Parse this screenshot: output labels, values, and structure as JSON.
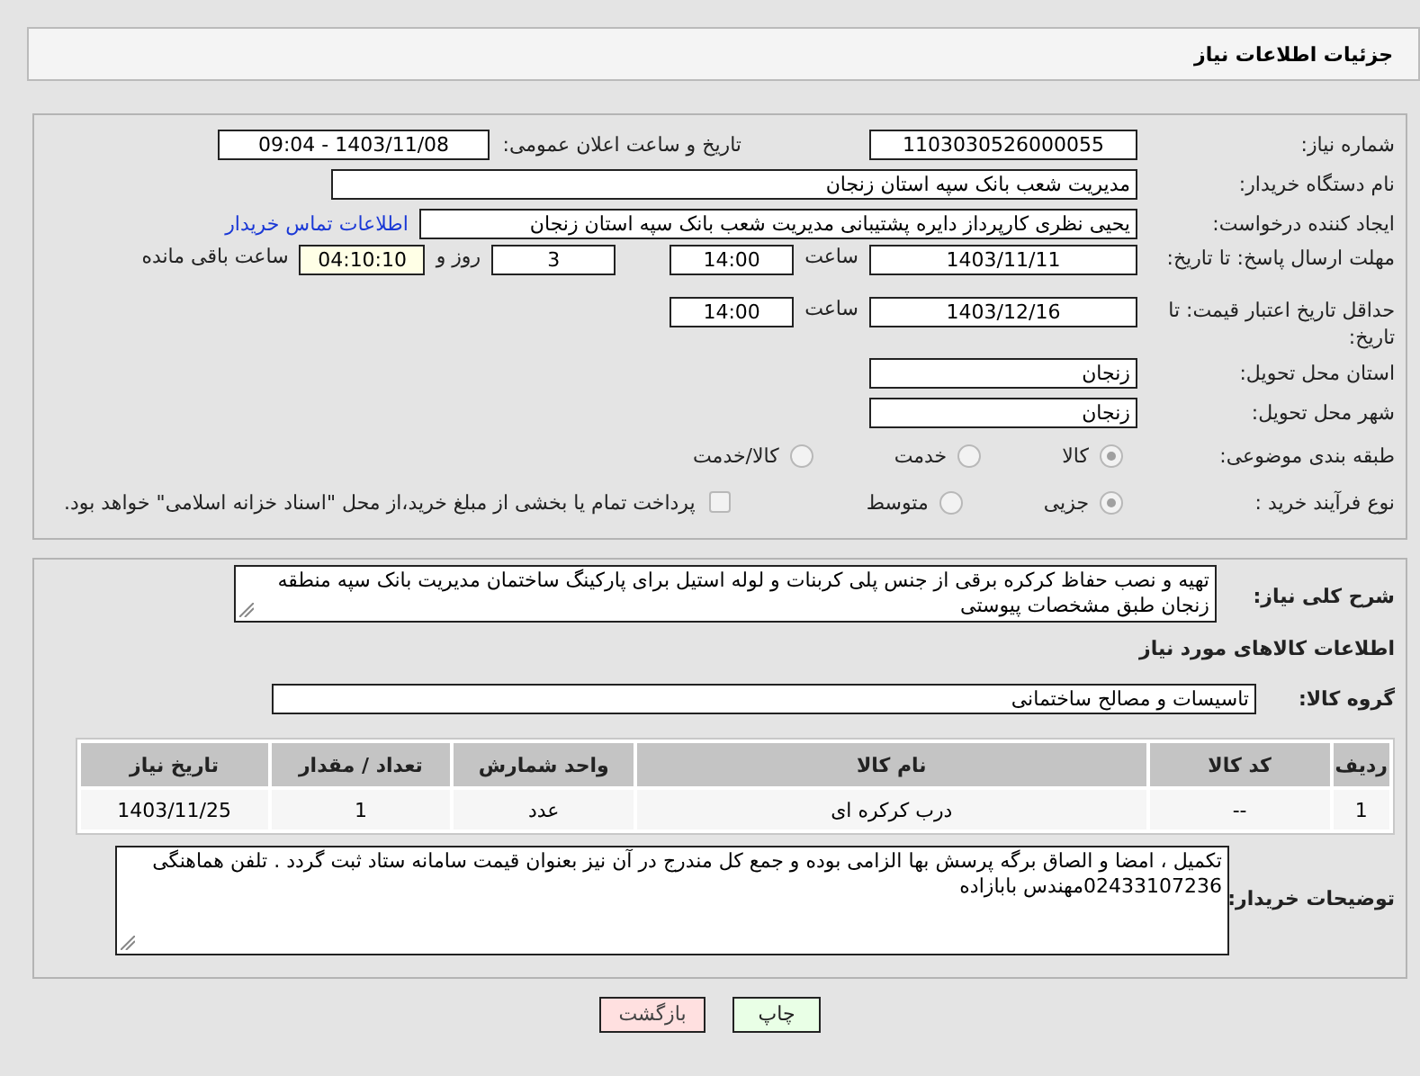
{
  "header": {
    "title": "جزئیات اطلاعات نیاز"
  },
  "need_number": {
    "label": "شماره نیاز:",
    "value": "1103030526000055"
  },
  "announce": {
    "label": "تاریخ و ساعت اعلان عمومی:",
    "value": "1403/11/08 - 09:04"
  },
  "buyer": {
    "label": "نام دستگاه خریدار:",
    "value": "مدیریت شعب بانک سپه استان زنجان"
  },
  "requester": {
    "label": "ایجاد کننده درخواست:",
    "value": "یحیی نظری کارپرداز دایره پشتیبانی  مدیریت شعب بانک سپه استان زنجان",
    "link": "اطلاعات تماس خریدار"
  },
  "deadline": {
    "label": "مهلت ارسال پاسخ: تا تاریخ:",
    "date": "1403/11/11",
    "time_label": "ساعت",
    "time": "14:00",
    "days": "3",
    "days_label": "روز و",
    "remaining": "04:10:10",
    "remaining_label": "ساعت باقی مانده"
  },
  "validity": {
    "label": "حداقل تاریخ اعتبار قیمت: تا تاریخ:",
    "date": "1403/12/16",
    "time_label": "ساعت",
    "time": "14:00"
  },
  "province": {
    "label": "استان محل تحویل:",
    "value": "زنجان"
  },
  "city": {
    "label": "شهر محل تحویل:",
    "value": "زنجان"
  },
  "category": {
    "label": "طبقه بندی موضوعی:",
    "options": [
      {
        "label": "کالا",
        "selected": true
      },
      {
        "label": "خدمت",
        "selected": false
      },
      {
        "label": "کالا/خدمت",
        "selected": false
      }
    ]
  },
  "process": {
    "label": "نوع فرآیند خرید :",
    "options": [
      {
        "label": "جزیی",
        "selected": true
      },
      {
        "label": "متوسط",
        "selected": false
      }
    ],
    "payment": {
      "checked": false,
      "text": "پرداخت تمام یا بخشی از مبلغ خرید،از محل \"اسناد خزانه اسلامی\" خواهد بود."
    }
  },
  "description": {
    "label": "شرح کلی نیاز:",
    "value": "تهیه و نصب حفاظ کرکره برقی از جنس پلی کربنات و لوله استیل برای پارکینگ ساختمان مدیریت بانک سپه منطقه زنجان طبق مشخصات پیوستی"
  },
  "goods_title": "اطلاعات کالاهای مورد نیاز",
  "goods_group": {
    "label": "گروه کالا:",
    "value": "تاسیسات و مصالح ساختمانی"
  },
  "table": {
    "columns": [
      "ردیف",
      "کد کالا",
      "نام کالا",
      "واحد شمارش",
      "تعداد / مقدار",
      "تاریخ نیاز"
    ],
    "rows": [
      [
        "1",
        "--",
        "درب کرکره ای",
        "عدد",
        "1",
        "1403/11/25"
      ]
    ]
  },
  "notes": {
    "label": "توضیحات خریدار:",
    "value": "تکمیل ، امضا و الصاق برگه پرسش بها الزامی بوده و جمع کل مندرج در آن نیز بعنوان قیمت سامانه ستاد ثبت گردد . تلفن هماهنگی 02433107236مهندس بابازاده"
  },
  "buttons": [
    {
      "label": "چاپ",
      "kind": "print"
    },
    {
      "label": "بازگشت",
      "kind": "back"
    }
  ]
}
